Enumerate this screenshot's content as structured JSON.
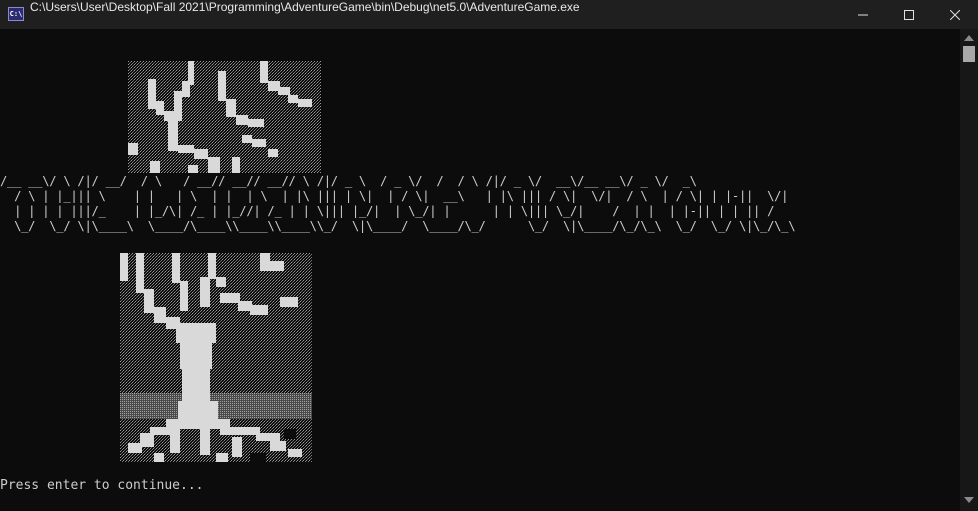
{
  "window": {
    "title": "C:\\Users\\User\\Desktop\\Fall 2021\\Programming\\AdventureGame\\bin\\Debug\\net5.0\\AdventureGame.exe",
    "icon_label": "C:\\",
    "controls": [
      "minimize-icon",
      "maximize-icon",
      "close-icon"
    ]
  },
  "console": {
    "banner_lines": [
      "/__ __\\/ \\ /|/ __/  / \\   / __// __// __// \\ /|/ _ \\  / _ \\/  /  / \\ /|/ _ \\/  __\\/__ __\\/ _ \\/  _\\",
      "  / \\ | |_||| \\    | |   | \\  | |  | \\  | |\\ ||| | \\|  | / \\|  __\\   | |\\ ||| / \\|  \\/|  / \\  | / \\| | |-||  \\/|",
      "  | | | | |||/_    | |_/\\| /_ | |_//| /_ | | \\||| |_/|  | \\_/| |      | | \\||| \\_/|    /  | |  | |-|| | | || /",
      "  \\_/  \\_/ \\|\\____\\  \\____/\\____\\\\____\\\\____\\\\_/  \\|\\____/  \\____/\\_/      \\_/  \\|\\____/\\_/\\_\\  \\_/  \\_/ \\|\\_/\\_\\"
    ],
    "prompt": "Press enter to continue..."
  },
  "colors": {
    "background": "#0c0c0c",
    "titlebar": "#1f1f1f",
    "text": "#cccccc",
    "art_light": "#d9d9d9"
  }
}
